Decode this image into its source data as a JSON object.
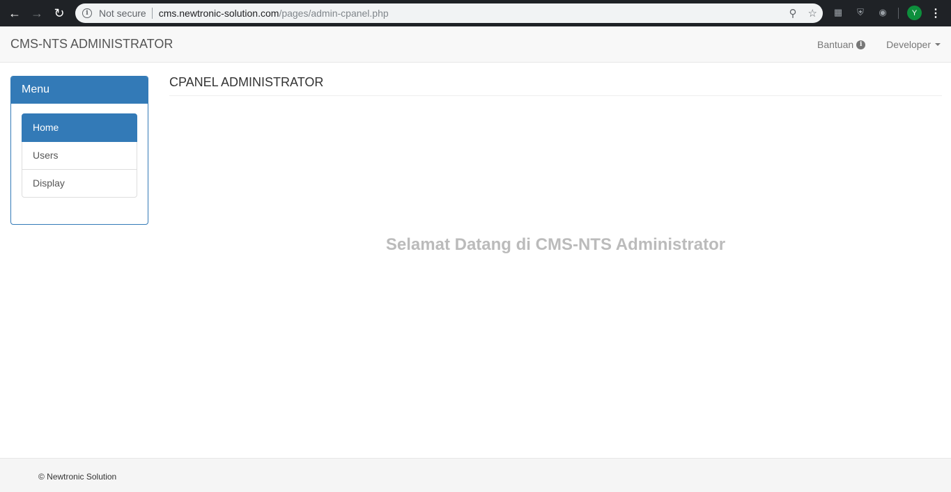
{
  "browser": {
    "security_label": "Not secure",
    "url_host": "cms.newtronic-solution.com",
    "url_path": "/pages/admin-cpanel.php",
    "profile_initial": "Y",
    "icons": [
      "back-arrow-icon",
      "forward-arrow-icon",
      "reload-icon",
      "info-icon",
      "key-icon",
      "star-icon",
      "extension-icon",
      "shield-icon",
      "camera-icon",
      "menu-kebab-icon"
    ]
  },
  "navbar": {
    "brand": "CMS-NTS ADMINISTRATOR",
    "help_label": "Bantuan",
    "user_label": "Developer"
  },
  "sidebar": {
    "title": "Menu",
    "items": [
      {
        "label": "Home",
        "active": true
      },
      {
        "label": "Users",
        "active": false
      },
      {
        "label": "Display",
        "active": false
      }
    ]
  },
  "main": {
    "heading": "CPANEL ADMINISTRATOR",
    "welcome": "Selamat Datang di CMS-NTS Administrator"
  },
  "footer": {
    "text": "© Newtronic Solution"
  },
  "colors": {
    "primary": "#337ab7",
    "navbar_bg": "#f8f8f8",
    "welcome_text": "#bbbbbb"
  }
}
